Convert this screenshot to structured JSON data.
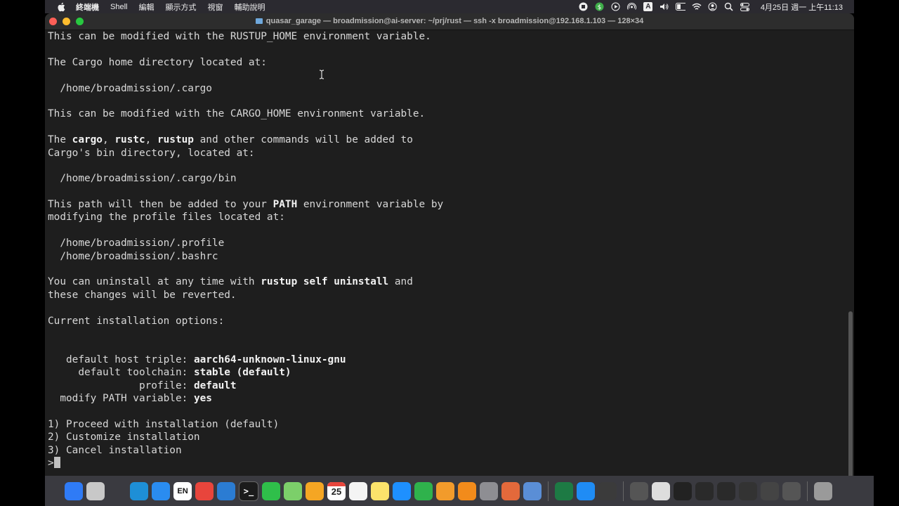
{
  "menubar": {
    "app_name": "終端機",
    "menus": [
      "Shell",
      "編輯",
      "顯示方式",
      "視窗",
      "輔助說明"
    ],
    "input_source": "A",
    "clock": "4月25日 週一 上午11:13"
  },
  "window": {
    "title": "quasar_garage — broadmission@ai-server: ~/prj/rust — ssh -x broadmission@192.168.1.103 — 128×34"
  },
  "terminal": {
    "lines": [
      [
        {
          "t": "This can be modified with the RUSTUP_HOME environment variable."
        }
      ],
      [],
      [
        {
          "t": "The Cargo home directory located at:"
        }
      ],
      [],
      [
        {
          "t": "  /home/broadmission/.cargo"
        }
      ],
      [],
      [
        {
          "t": "This can be modified with the CARGO_HOME environment variable."
        }
      ],
      [],
      [
        {
          "t": "The "
        },
        {
          "t": "cargo",
          "b": true
        },
        {
          "t": ", "
        },
        {
          "t": "rustc",
          "b": true
        },
        {
          "t": ", "
        },
        {
          "t": "rustup",
          "b": true
        },
        {
          "t": " and other commands will be added to"
        }
      ],
      [
        {
          "t": "Cargo's bin directory, located at:"
        }
      ],
      [],
      [
        {
          "t": "  /home/broadmission/.cargo/bin"
        }
      ],
      [],
      [
        {
          "t": "This path will then be added to your "
        },
        {
          "t": "PATH",
          "b": true
        },
        {
          "t": " environment variable by"
        }
      ],
      [
        {
          "t": "modifying the profile files located at:"
        }
      ],
      [],
      [
        {
          "t": "  /home/broadmission/.profile"
        }
      ],
      [
        {
          "t": "  /home/broadmission/.bashrc"
        }
      ],
      [],
      [
        {
          "t": "You can uninstall at any time with "
        },
        {
          "t": "rustup self uninstall",
          "b": true
        },
        {
          "t": " and"
        }
      ],
      [
        {
          "t": "these changes will be reverted."
        }
      ],
      [],
      [
        {
          "t": "Current installation options:"
        }
      ],
      [],
      [],
      [
        {
          "t": "   default host triple: "
        },
        {
          "t": "aarch64-unknown-linux-gnu",
          "b": true
        }
      ],
      [
        {
          "t": "     default toolchain: "
        },
        {
          "t": "stable (default)",
          "b": true
        }
      ],
      [
        {
          "t": "               profile: "
        },
        {
          "t": "default",
          "b": true
        }
      ],
      [
        {
          "t": "  modify PATH variable: "
        },
        {
          "t": "yes",
          "b": true
        }
      ],
      [],
      [
        {
          "t": "1) Proceed with installation (default)"
        }
      ],
      [
        {
          "t": "2) Customize installation"
        }
      ],
      [
        {
          "t": "3) Cancel installation"
        }
      ],
      [
        {
          "t": ">"
        }
      ]
    ]
  },
  "dock": {
    "calendar_day": "25",
    "language_label": "EN",
    "icons": [
      {
        "name": "finder-icon",
        "color": "#2f7bf6"
      },
      {
        "name": "launchpad-icon",
        "color": "#c8c8c8"
      },
      {
        "name": "checkmark-app-icon",
        "color": "#3a3a40"
      },
      {
        "name": "edge-icon",
        "color": "#1e8fd6"
      },
      {
        "name": "safari-icon",
        "color": "#2a8cf0"
      },
      {
        "name": "language-icon",
        "color": "#ffffff"
      },
      {
        "name": "chrome-icon",
        "color": "#e8453c"
      },
      {
        "name": "vscode-icon",
        "color": "#2b7cd3"
      },
      {
        "name": "terminal-icon",
        "color": "#1b1b1b"
      },
      {
        "name": "facetime-icon",
        "color": "#2fbf4a"
      },
      {
        "name": "maps-icon",
        "color": "#7ccf6a"
      },
      {
        "name": "photos-icon",
        "color": "#f5a623"
      },
      {
        "name": "calendar-icon",
        "color": "#ffffff"
      },
      {
        "name": "reminders-icon",
        "color": "#f4f4f4"
      },
      {
        "name": "notes-icon",
        "color": "#fbe36b"
      },
      {
        "name": "keynote-icon",
        "color": "#1e90ff"
      },
      {
        "name": "numbers-icon",
        "color": "#2fb24c"
      },
      {
        "name": "pages-icon",
        "color": "#f29b2b"
      },
      {
        "name": "vlc-icon",
        "color": "#f28b1b"
      },
      {
        "name": "system-preferences-icon",
        "color": "#8e8e93"
      },
      {
        "name": "matlab-icon",
        "color": "#e3693b"
      },
      {
        "name": "preview-icon",
        "color": "#5a8ed6"
      },
      {
        "name": "excel-icon",
        "color": "#1d7a44"
      },
      {
        "name": "app-store-icon",
        "color": "#1f8cf5"
      },
      {
        "name": "quicktime-icon",
        "color": "#3b3b3b"
      },
      {
        "name": "window-thumbnail-1-icon",
        "color": "#555555"
      },
      {
        "name": "window-thumbnail-2-icon",
        "color": "#dddddd"
      },
      {
        "name": "window-thumbnail-3-icon",
        "color": "#222222"
      },
      {
        "name": "window-thumbnail-4-icon",
        "color": "#2a2a2a"
      },
      {
        "name": "window-thumbnail-5-icon",
        "color": "#2a2a2a"
      },
      {
        "name": "window-thumbnail-6-icon",
        "color": "#333333"
      },
      {
        "name": "window-thumbnail-7-icon",
        "color": "#444444"
      },
      {
        "name": "window-thumbnail-8-icon",
        "color": "#555555"
      },
      {
        "name": "trash-icon",
        "color": "#9a9a9a"
      }
    ]
  }
}
